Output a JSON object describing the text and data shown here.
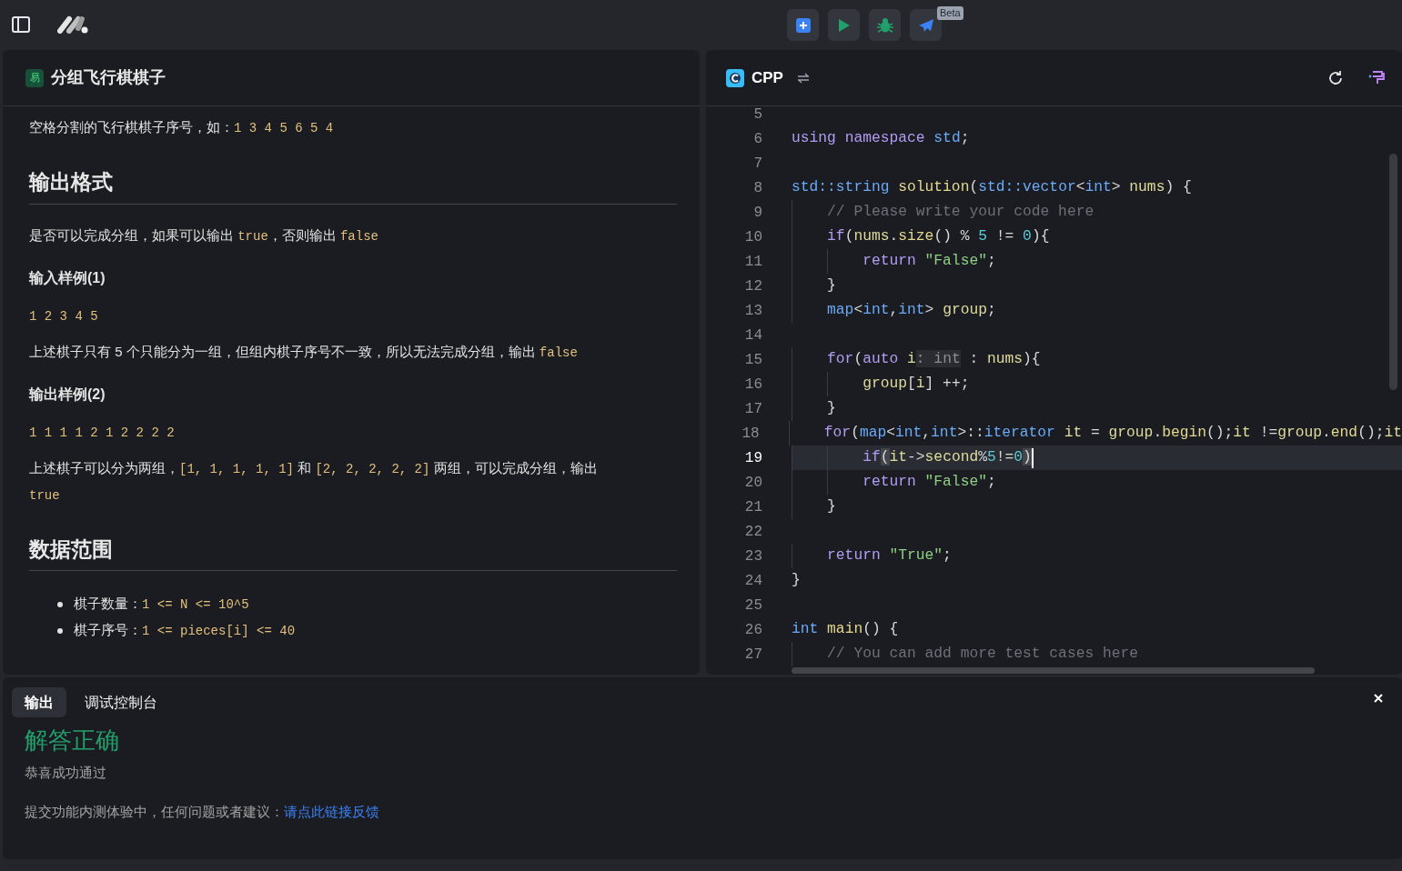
{
  "toolbar": {
    "badge": "Beta"
  },
  "problem": {
    "difficulty": "易",
    "title": "分组飞行棋棋子",
    "blocks": [
      {
        "kind": "paragraph",
        "parts": [
          {
            "kind": "text",
            "text": "空格分割的飞行棋棋子序号，如："
          },
          {
            "kind": "code",
            "text": "1 3 4 5 6 5 4"
          }
        ]
      },
      {
        "kind": "heading",
        "text": "输出格式"
      },
      {
        "kind": "paragraph",
        "parts": [
          {
            "kind": "text",
            "text": "是否可以完成分组，如果可以输出 "
          },
          {
            "kind": "code",
            "text": "true"
          },
          {
            "kind": "text",
            "text": "，否则输出 "
          },
          {
            "kind": "code",
            "text": "false"
          }
        ]
      },
      {
        "kind": "subheading",
        "text": "输入样例(1)"
      },
      {
        "kind": "sample",
        "text": "1 2 3 4 5"
      },
      {
        "kind": "paragraph",
        "parts": [
          {
            "kind": "text",
            "text": "上述棋子只有 5 个只能分为一组，但组内棋子序号不一致，所以无法完成分组，输出 "
          },
          {
            "kind": "code",
            "text": "false"
          }
        ]
      },
      {
        "kind": "subheading",
        "text": "输出样例(2)"
      },
      {
        "kind": "sample",
        "text": "1 1 1 1 2 1 2 2 2 2"
      },
      {
        "kind": "paragraph",
        "parts": [
          {
            "kind": "text",
            "text": "上述棋子可以分为两组，"
          },
          {
            "kind": "code",
            "text": "[1, 1, 1, 1, 1]"
          },
          {
            "kind": "text",
            "text": " 和 "
          },
          {
            "kind": "code",
            "text": "[2, 2, 2, 2, 2]"
          },
          {
            "kind": "text",
            "text": " 两组，可以完成分组，输出 "
          },
          {
            "kind": "code",
            "text": "true"
          }
        ]
      },
      {
        "kind": "heading",
        "text": "数据范围"
      },
      {
        "kind": "list",
        "items": [
          {
            "parts": [
              {
                "kind": "text",
                "text": "棋子数量："
              },
              {
                "kind": "code",
                "text": "1 <= N <= 10^5"
              }
            ]
          },
          {
            "parts": [
              {
                "kind": "text",
                "text": "棋子序号："
              },
              {
                "kind": "code",
                "text": "1 <= pieces[i] <= 40"
              }
            ]
          }
        ]
      }
    ]
  },
  "editor": {
    "language": "CPP",
    "lines": [
      {
        "number": "5",
        "current": false
      },
      {
        "number": "6",
        "current": false,
        "tokens": [
          {
            "kind": "keyword",
            "text": "using "
          },
          {
            "kind": "keyword",
            "text": "namespace "
          },
          {
            "kind": "type",
            "text": "std"
          },
          {
            "kind": "plain",
            "text": ";"
          }
        ]
      },
      {
        "number": "7",
        "current": false
      },
      {
        "number": "8",
        "current": false,
        "tokens": [
          {
            "kind": "type",
            "text": "std::string "
          },
          {
            "kind": "func",
            "text": "solution"
          },
          {
            "kind": "plain",
            "text": "("
          },
          {
            "kind": "type",
            "text": "std::vector"
          },
          {
            "kind": "plain",
            "text": "<"
          },
          {
            "kind": "type",
            "text": "int"
          },
          {
            "kind": "plain",
            "text": "> "
          },
          {
            "kind": "var",
            "text": "nums"
          },
          {
            "kind": "plain",
            "text": ") {"
          }
        ]
      },
      {
        "number": "9",
        "current": false,
        "tokens": [
          {
            "kind": "comment",
            "text": "    // Please write your code here"
          }
        ]
      },
      {
        "number": "10",
        "current": false,
        "tokens": [
          {
            "kind": "keyword",
            "text": "    if"
          },
          {
            "kind": "plain",
            "text": "("
          },
          {
            "kind": "var",
            "text": "nums"
          },
          {
            "kind": "plain",
            "text": "."
          },
          {
            "kind": "func",
            "text": "size"
          },
          {
            "kind": "plain",
            "text": "() % "
          },
          {
            "kind": "number",
            "text": "5"
          },
          {
            "kind": "plain",
            "text": " != "
          },
          {
            "kind": "number",
            "text": "0"
          },
          {
            "kind": "plain",
            "text": "){"
          }
        ]
      },
      {
        "number": "11",
        "current": false,
        "tokens": [
          {
            "kind": "keyword",
            "text": "        return "
          },
          {
            "kind": "string",
            "text": "\"False\""
          },
          {
            "kind": "plain",
            "text": ";"
          }
        ]
      },
      {
        "number": "12",
        "current": false,
        "tokens": [
          {
            "kind": "plain",
            "text": "    }"
          }
        ]
      },
      {
        "number": "13",
        "current": false,
        "tokens": [
          {
            "kind": "type",
            "text": "    map"
          },
          {
            "kind": "plain",
            "text": "<"
          },
          {
            "kind": "type",
            "text": "int"
          },
          {
            "kind": "plain",
            "text": ","
          },
          {
            "kind": "type",
            "text": "int"
          },
          {
            "kind": "plain",
            "text": "> "
          },
          {
            "kind": "var",
            "text": "group"
          },
          {
            "kind": "plain",
            "text": ";"
          }
        ]
      },
      {
        "number": "14",
        "current": false
      },
      {
        "number": "15",
        "current": false,
        "tokens": [
          {
            "kind": "keyword",
            "text": "    for"
          },
          {
            "kind": "plain",
            "text": "("
          },
          {
            "kind": "keyword",
            "text": "auto "
          },
          {
            "kind": "var",
            "text": "i"
          },
          {
            "kind": "hint",
            "text": ": int"
          },
          {
            "kind": "plain",
            "text": " : "
          },
          {
            "kind": "var",
            "text": "nums"
          },
          {
            "kind": "plain",
            "text": "){"
          }
        ]
      },
      {
        "number": "16",
        "current": false,
        "tokens": [
          {
            "kind": "var",
            "text": "        group"
          },
          {
            "kind": "plain",
            "text": "["
          },
          {
            "kind": "var",
            "text": "i"
          },
          {
            "kind": "plain",
            "text": "] ++;"
          }
        ]
      },
      {
        "number": "17",
        "current": false,
        "tokens": [
          {
            "kind": "plain",
            "text": "    }"
          }
        ]
      },
      {
        "number": "18",
        "current": false,
        "tokens": [
          {
            "kind": "keyword",
            "text": "    for"
          },
          {
            "kind": "plain",
            "text": "("
          },
          {
            "kind": "type",
            "text": "map"
          },
          {
            "kind": "plain",
            "text": "<"
          },
          {
            "kind": "type",
            "text": "int"
          },
          {
            "kind": "plain",
            "text": ","
          },
          {
            "kind": "type",
            "text": "int"
          },
          {
            "kind": "plain",
            "text": ">::"
          },
          {
            "kind": "type",
            "text": "iterator "
          },
          {
            "kind": "var",
            "text": "it"
          },
          {
            "kind": "plain",
            "text": " = "
          },
          {
            "kind": "var",
            "text": "group"
          },
          {
            "kind": "plain",
            "text": "."
          },
          {
            "kind": "func",
            "text": "begin"
          },
          {
            "kind": "plain",
            "text": "();"
          },
          {
            "kind": "var",
            "text": "it"
          },
          {
            "kind": "plain",
            "text": " !="
          },
          {
            "kind": "var",
            "text": "group"
          },
          {
            "kind": "plain",
            "text": "."
          },
          {
            "kind": "func",
            "text": "end"
          },
          {
            "kind": "plain",
            "text": "();"
          },
          {
            "kind": "var",
            "text": "it"
          }
        ]
      },
      {
        "number": "19",
        "current": true,
        "tokens": [
          {
            "kind": "keyword",
            "text": "        if"
          },
          {
            "kind": "bracket",
            "text": "("
          },
          {
            "kind": "var",
            "text": "it"
          },
          {
            "kind": "plain",
            "text": "->"
          },
          {
            "kind": "var",
            "text": "second"
          },
          {
            "kind": "plain",
            "text": "%"
          },
          {
            "kind": "number",
            "text": "5"
          },
          {
            "kind": "plain",
            "text": "!="
          },
          {
            "kind": "number",
            "text": "0"
          },
          {
            "kind": "bracket",
            "text": ")"
          }
        ]
      },
      {
        "number": "20",
        "current": false,
        "tokens": [
          {
            "kind": "keyword",
            "text": "        return "
          },
          {
            "kind": "string",
            "text": "\"False\""
          },
          {
            "kind": "plain",
            "text": ";"
          }
        ]
      },
      {
        "number": "21",
        "current": false,
        "tokens": [
          {
            "kind": "plain",
            "text": "    }"
          }
        ]
      },
      {
        "number": "22",
        "current": false
      },
      {
        "number": "23",
        "current": false,
        "tokens": [
          {
            "kind": "keyword",
            "text": "    return "
          },
          {
            "kind": "string",
            "text": "\"True\""
          },
          {
            "kind": "plain",
            "text": ";"
          }
        ]
      },
      {
        "number": "24",
        "current": false,
        "tokens": [
          {
            "kind": "plain",
            "text": "}"
          }
        ]
      },
      {
        "number": "25",
        "current": false
      },
      {
        "number": "26",
        "current": false,
        "tokens": [
          {
            "kind": "type",
            "text": "int "
          },
          {
            "kind": "func",
            "text": "main"
          },
          {
            "kind": "plain",
            "text": "() {"
          }
        ]
      },
      {
        "number": "27",
        "current": false,
        "tokens": [
          {
            "kind": "comment",
            "text": "    // You can add more test cases here"
          }
        ]
      }
    ]
  },
  "output": {
    "tabs": [
      {
        "label": "输出",
        "selected": true
      },
      {
        "label": "调试控制台",
        "selected": false
      }
    ],
    "result": "解答正确",
    "message": "恭喜成功通过",
    "feedback": "提交功能内测体验中，任何问题或者建议：",
    "feedback_link": "请点此链接反馈"
  }
}
